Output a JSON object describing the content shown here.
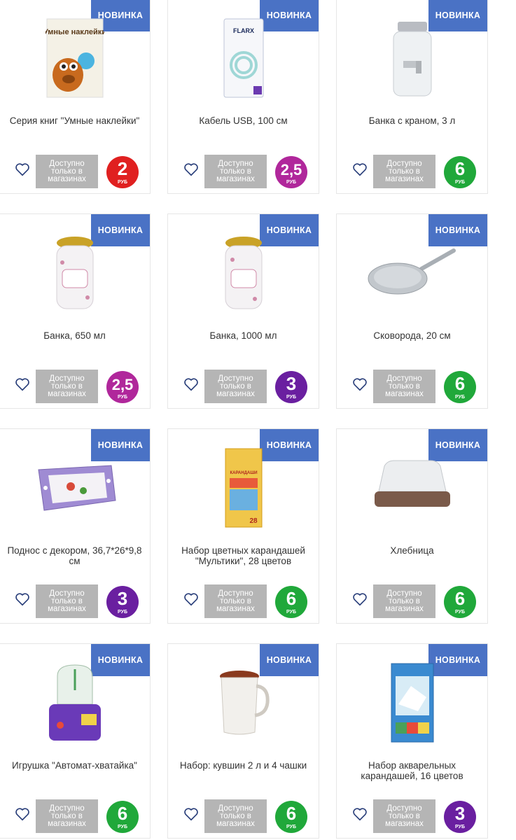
{
  "products": [
    {
      "name": "Серия книг \"Умные наклейки\"",
      "badge": "НОВИНКА",
      "availability": "Доступно только в магазинах",
      "price": "2",
      "currency": "РУБ",
      "price_color": "#e02020",
      "icon": "sticker-book-icon",
      "cover_title": "Умные наклейки"
    },
    {
      "name": "Кабель USB, 100 см",
      "badge": "НОВИНКА",
      "availability": "Доступно только в магазинах",
      "price": "2,5",
      "currency": "РУБ",
      "price_color": "#b0279b",
      "icon": "usb-cable-icon",
      "cover_title": "FLARX"
    },
    {
      "name": "Банка с краном, 3 л",
      "badge": "НОВИНКА",
      "availability": "Доступно только в магазинах",
      "price": "6",
      "currency": "РУБ",
      "price_color": "#20a83a",
      "icon": "tap-jar-icon"
    },
    {
      "name": "Банка, 650 мл",
      "badge": "НОВИНКА",
      "availability": "Доступно только в магазинах",
      "price": "2,5",
      "currency": "РУБ",
      "price_color": "#b0279b",
      "icon": "jar-icon"
    },
    {
      "name": "Банка, 1000 мл",
      "badge": "НОВИНКА",
      "availability": "Доступно только в магазинах",
      "price": "3",
      "currency": "РУБ",
      "price_color": "#6a1fa0",
      "icon": "jar-icon"
    },
    {
      "name": "Сковорода, 20 см",
      "badge": "НОВИНКА",
      "availability": "Доступно только в магазинах",
      "price": "6",
      "currency": "РУБ",
      "price_color": "#20a83a",
      "icon": "frying-pan-icon"
    },
    {
      "name": "Поднос с декором, 36,7*26*9,8 см",
      "badge": "НОВИНКА",
      "availability": "Доступно только в магазинах",
      "price": "3",
      "currency": "РУБ",
      "price_color": "#6a1fa0",
      "icon": "tray-icon"
    },
    {
      "name": "Набор цветных карандашей \"Мультики\", 28 цветов",
      "badge": "НОВИНКА",
      "availability": "Доступно только в магазинах",
      "price": "6",
      "currency": "РУБ",
      "price_color": "#20a83a",
      "icon": "pencils-box-icon",
      "cover_title": "КАРАНДАШИ",
      "cover_count": "28"
    },
    {
      "name": "Хлебница",
      "badge": "НОВИНКА",
      "availability": "Доступно только в магазинах",
      "price": "6",
      "currency": "РУБ",
      "price_color": "#20a83a",
      "icon": "bread-box-icon"
    },
    {
      "name": "Игрушка \"Автомат-хватайка\"",
      "badge": "НОВИНКА",
      "availability": "Доступно только в магазинах",
      "price": "6",
      "currency": "РУБ",
      "price_color": "#20a83a",
      "icon": "claw-machine-icon"
    },
    {
      "name": "Набор: кувшин 2 л и 4 чашки",
      "badge": "НОВИНКА",
      "availability": "Доступно только в магазинах",
      "price": "6",
      "currency": "РУБ",
      "price_color": "#20a83a",
      "icon": "pitcher-icon"
    },
    {
      "name": "Набор акварельных карандашей, 16 цветов",
      "badge": "НОВИНКА",
      "availability": "Доступно только в магазинах",
      "price": "3",
      "currency": "РУБ",
      "price_color": "#6a1fa0",
      "icon": "watercolor-pencils-icon"
    }
  ]
}
